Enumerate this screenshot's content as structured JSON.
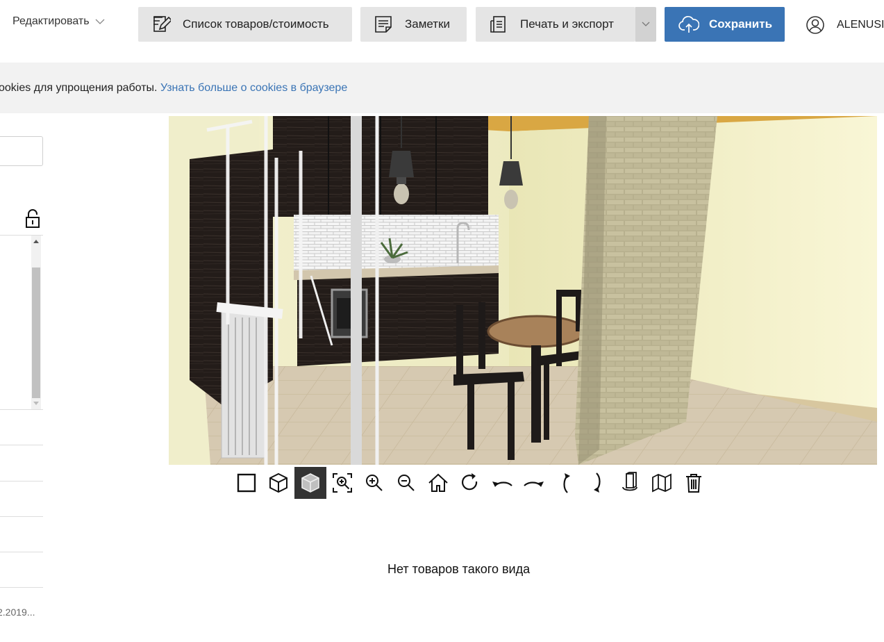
{
  "toolbar": {
    "edit_label": "Редактировать",
    "list_label": "Список товаров/стоимость",
    "notes_label": "Заметки",
    "print_label": "Печать и экспорт",
    "save_label": "Сохранить",
    "user_name": "ALENUSI",
    "icons": {
      "edit_dropdown": "chevron-down-icon",
      "list": "pencil-list-icon",
      "notes": "note-icon",
      "print": "document-stack-icon",
      "print_dropdown": "chevron-down-icon",
      "save": "cloud-upload-icon",
      "user": "user-circle-icon"
    },
    "save_color": "#3a74b5"
  },
  "cookie_banner": {
    "text": "ookies для упрощения работы. ",
    "link": "Узнать больше о cookies в браузере"
  },
  "left_panel": {
    "lock_icon": "unlock-icon",
    "date_text": "2.2019..."
  },
  "view_toolbar": {
    "tools": [
      {
        "name": "2d-view-icon",
        "active": false
      },
      {
        "name": "3d-wireframe-icon",
        "active": false
      },
      {
        "name": "3d-solid-icon",
        "active": true
      },
      {
        "name": "zoom-fit-icon",
        "active": false
      },
      {
        "name": "zoom-in-icon",
        "active": false
      },
      {
        "name": "zoom-out-icon",
        "active": false
      },
      {
        "name": "home-icon",
        "active": false
      },
      {
        "name": "rotate-icon",
        "active": false
      },
      {
        "name": "rotate-left-icon",
        "active": false
      },
      {
        "name": "rotate-right-icon",
        "active": false
      },
      {
        "name": "tilt-up-icon",
        "active": false
      },
      {
        "name": "tilt-down-icon",
        "active": false
      },
      {
        "name": "rotate-object-icon",
        "active": false
      },
      {
        "name": "walls-icon",
        "active": false
      },
      {
        "name": "trash-icon",
        "active": false
      }
    ]
  },
  "product_panel": {
    "empty_message": "Нет товаров такого вида"
  }
}
